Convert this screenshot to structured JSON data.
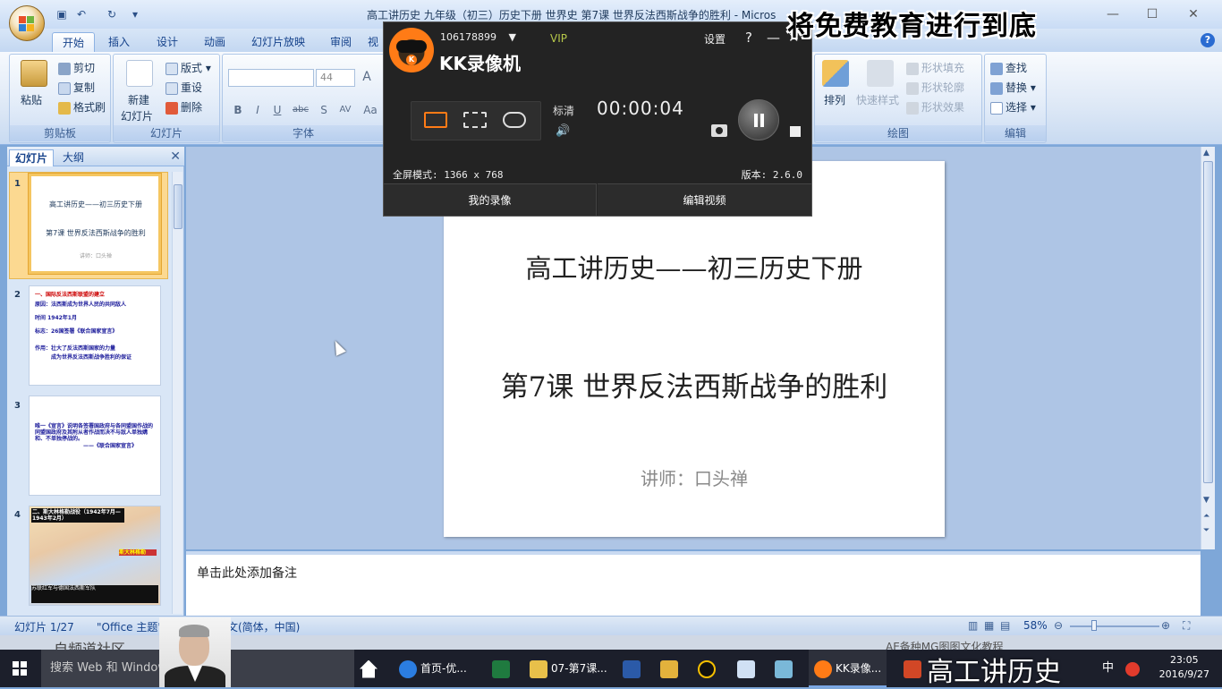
{
  "window": {
    "title": "高工讲历史 九年级（初三）历史下册 世界史  第7课 世界反法西斯战争的胜利 - Microsoft PowerPoint",
    "title_visible": "高工讲历史 九年级（初三）历史下册 世界史  第7课 世界反法西斯战争的胜利 - Micros",
    "watermark_top": "将免费教育进行到底"
  },
  "ribbon": {
    "tabs": [
      "开始",
      "插入",
      "设计",
      "动画",
      "幻灯片放映",
      "审阅",
      "视"
    ],
    "clipboard": {
      "paste": "粘贴",
      "cut": "剪切",
      "copy": "复制",
      "format_painter": "格式刷",
      "label": "剪贴板"
    },
    "slides": {
      "new_slide": "新建",
      "new_slide2": "幻灯片",
      "layout": "版式",
      "reset": "重设",
      "delete": "删除",
      "label": "幻灯片"
    },
    "font": {
      "size": "44",
      "label": "字体"
    },
    "drawing": {
      "arrange": "排列",
      "quick_styles": "快速样式",
      "shape_fill": "形状填充",
      "shape_outline": "形状轮廓",
      "shape_effects": "形状效果",
      "label": "绘图"
    },
    "editing": {
      "find": "查找",
      "replace": "替换",
      "select": "选择",
      "label": "编辑"
    }
  },
  "panel": {
    "tab_slides": "幻灯片",
    "tab_outline": "大纲",
    "thumbs": [
      {
        "num": "1",
        "l1": "高工讲历史——初三历史下册",
        "l2": "第7课 世界反法西斯战争的胜利",
        "l3": "讲师：口头禅"
      },
      {
        "num": "2",
        "l1": "一、国际反法西斯联盟的建立",
        "l2": "原因：法西斯成为世界人民的共同敌人",
        "l3": "时间  1942年1月",
        "l4": "标志：26国签署《联合国家宣言》",
        "l5": "作用：壮大了反法西斯国家的力量",
        "l6": "成为世界反法西斯战争胜利的保证"
      },
      {
        "num": "3",
        "l1": "唯一《宣言》说明各签署国政府与各同盟国作战的同盟国政府及其附从者作战而决不与敌人单独媾和、不单独停战的。",
        "l2": "——《联合国家宣言》"
      },
      {
        "num": "4",
        "l1": "二、斯大林格勒战役（1942年7月—1943年2月）",
        "l2": "苏联红军与德国法西斯军队",
        "l3": "斯大林格勒"
      }
    ]
  },
  "slide": {
    "title": "高工讲历史——初三历史下册",
    "subtitle": "第7课 世界反法西斯战争的胜利",
    "author": "讲师：口头禅"
  },
  "notes": {
    "placeholder": "单击此处添加备注"
  },
  "status": {
    "slide_count": "幻灯片 1/27",
    "theme": "\"Office 主题\"",
    "language": "文(简体，中国)",
    "zoom": "58%"
  },
  "kk": {
    "user": "106178899",
    "vip": "VIP",
    "brand": "KK录像机",
    "settings": "设置",
    "help": "?",
    "minimize": "—",
    "close": "✕",
    "quality": "标清",
    "timer": "00:00:04",
    "mode_text": "全屏模式: 1366 x 768",
    "version": "版本: 2.6.0",
    "my_recordings": "我的录像",
    "edit_video": "编辑视频"
  },
  "taskbar": {
    "search": "搜索 Web 和 Windows",
    "items": [
      "首页-优...",
      "07-第7课...",
      "KK录像..."
    ],
    "clock_time": "23:05",
    "clock_date": "2016/9/27",
    "ime": "中"
  },
  "behind": {
    "left_text": "自频道社区",
    "right_text": "AE备种MG图图文化教程"
  },
  "watermark_bottom": "高工讲历史",
  "colors": {
    "ribbon_bg": "#dde8f6",
    "editor_bg": "#aec5e5",
    "kk_bg": "#232323",
    "kk_orange": "#ff7b16",
    "taskbar": "#1c1f2b"
  }
}
